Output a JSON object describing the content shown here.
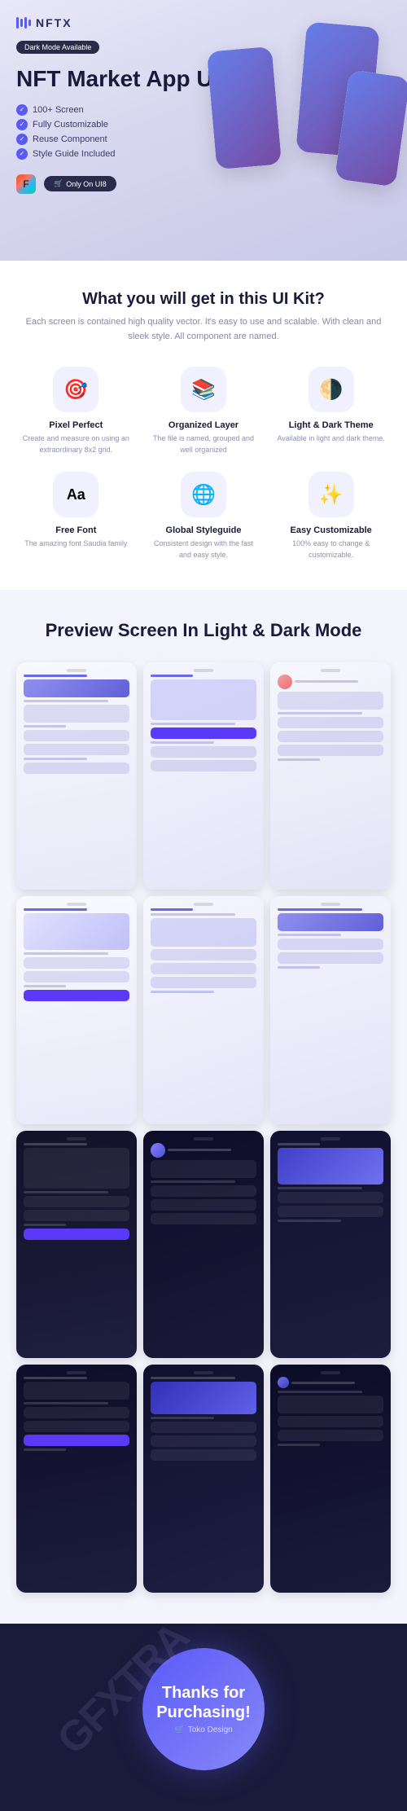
{
  "brand": {
    "logo_text": "NFTX",
    "dark_mode_badge": "Dark Mode Available",
    "uib_badge": "Only On UI8"
  },
  "hero": {
    "title": "NFT Market App UI Kit",
    "features": [
      "100+ Screen",
      "Fully Customizable",
      "Reuse Component",
      "Style Guide Included"
    ]
  },
  "what_section": {
    "title": "What you will get in this UI Kit?",
    "subtitle": "Each screen is contained high quality vector. It's easy to use and scalable.\nWith clean and sleek style. All component are named.",
    "cards": [
      {
        "icon": "🎯",
        "title": "Pixel Perfect",
        "desc": "Create and measure on using an extraordinary 8x2 grid."
      },
      {
        "icon": "📚",
        "title": "Organized Layer",
        "desc": "The file is named, grouped and well organized"
      },
      {
        "icon": "🌗",
        "title": "Light & Dark Theme",
        "desc": "Available in light and dark theme."
      },
      {
        "icon": "Aa",
        "title": "Free Font",
        "desc": "The amazing font Saudia family"
      },
      {
        "icon": "🌐",
        "title": "Global Styleguide",
        "desc": "Consistent design with the fast and easy style."
      },
      {
        "icon": "✨",
        "title": "Easy Customizable",
        "desc": "100% easy to change & customizable."
      }
    ]
  },
  "preview_section": {
    "title": "Preview Screen\nIn Light & Dark Mode"
  },
  "thanks": {
    "line1": "Thanks for",
    "line2": "Purchasing!",
    "sub": "Toko Design"
  },
  "watermark": "GFXTRA"
}
